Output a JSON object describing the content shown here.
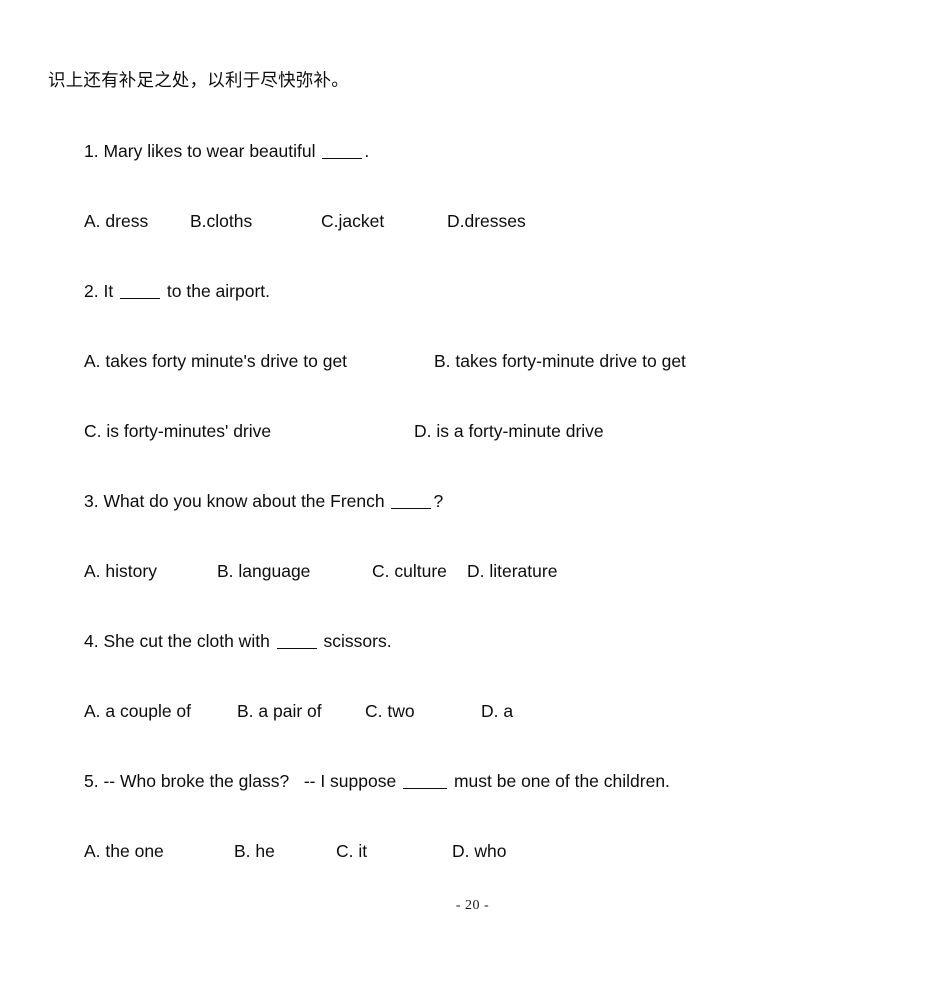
{
  "document": {
    "header_text": "识上还有补足之处，以利于尽快弥补。",
    "page_footer": "- 20 -"
  },
  "questions": [
    {
      "stem_before": "1. Mary likes to wear beautiful ",
      "stem_after": ".",
      "options": [
        {
          "label": "A. dress"
        },
        {
          "label": "B.cloths"
        },
        {
          "label": "C.jacket"
        },
        {
          "label": "D.dresses"
        }
      ]
    },
    {
      "stem_before": "2. It ",
      "stem_after": " to the airport.",
      "options": [
        {
          "label": "A. takes forty minute's drive to get"
        },
        {
          "label": "B. takes forty-minute drive to get"
        },
        {
          "label": "C. is forty-minutes' drive"
        },
        {
          "label": "D. is a forty-minute drive"
        }
      ]
    },
    {
      "stem_before": "3. What do you know about the French ",
      "stem_after": "?",
      "options": [
        {
          "label": "A. history"
        },
        {
          "label": "B. language"
        },
        {
          "label": "C. culture"
        },
        {
          "label": "D. literature"
        }
      ]
    },
    {
      "stem_before": "4. She cut the cloth with ",
      "stem_after": " scissors.",
      "options": [
        {
          "label": "A. a couple of"
        },
        {
          "label": "B. a pair of"
        },
        {
          "label": "C. two"
        },
        {
          "label": "D. a"
        }
      ]
    },
    {
      "stem_before": "5. -- Who broke the glass?   -- I suppose ",
      "stem_after": " must be one of the children.",
      "options": [
        {
          "label": "A. the one"
        },
        {
          "label": "B. he"
        },
        {
          "label": "C. it"
        },
        {
          "label": "D. who"
        }
      ]
    }
  ]
}
